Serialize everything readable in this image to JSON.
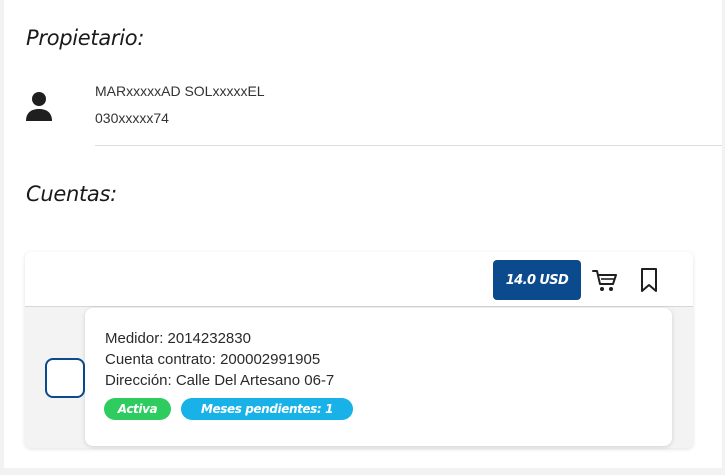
{
  "owner": {
    "title": "Propietario:",
    "name": "MARxxxxxAD SOLxxxxxEL",
    "id": "030xxxxx74"
  },
  "accounts": {
    "title": "Cuentas:",
    "items": [
      {
        "amount": "14.0 USD",
        "meter_line": "Medidor: 2014232830",
        "contract_line": "Cuenta contrato: 200002991905",
        "address_line": "Dirección: Calle Del Artesano 06-7",
        "status": "Activa",
        "pending": "Meses pendientes: 1"
      }
    ]
  },
  "colors": {
    "primary": "#0b4a8c",
    "active": "#2ecc5f",
    "pending": "#19b2e8"
  },
  "icons": {
    "owner": "person-icon",
    "cart": "cart-icon",
    "bookmark": "bookmark-icon"
  }
}
